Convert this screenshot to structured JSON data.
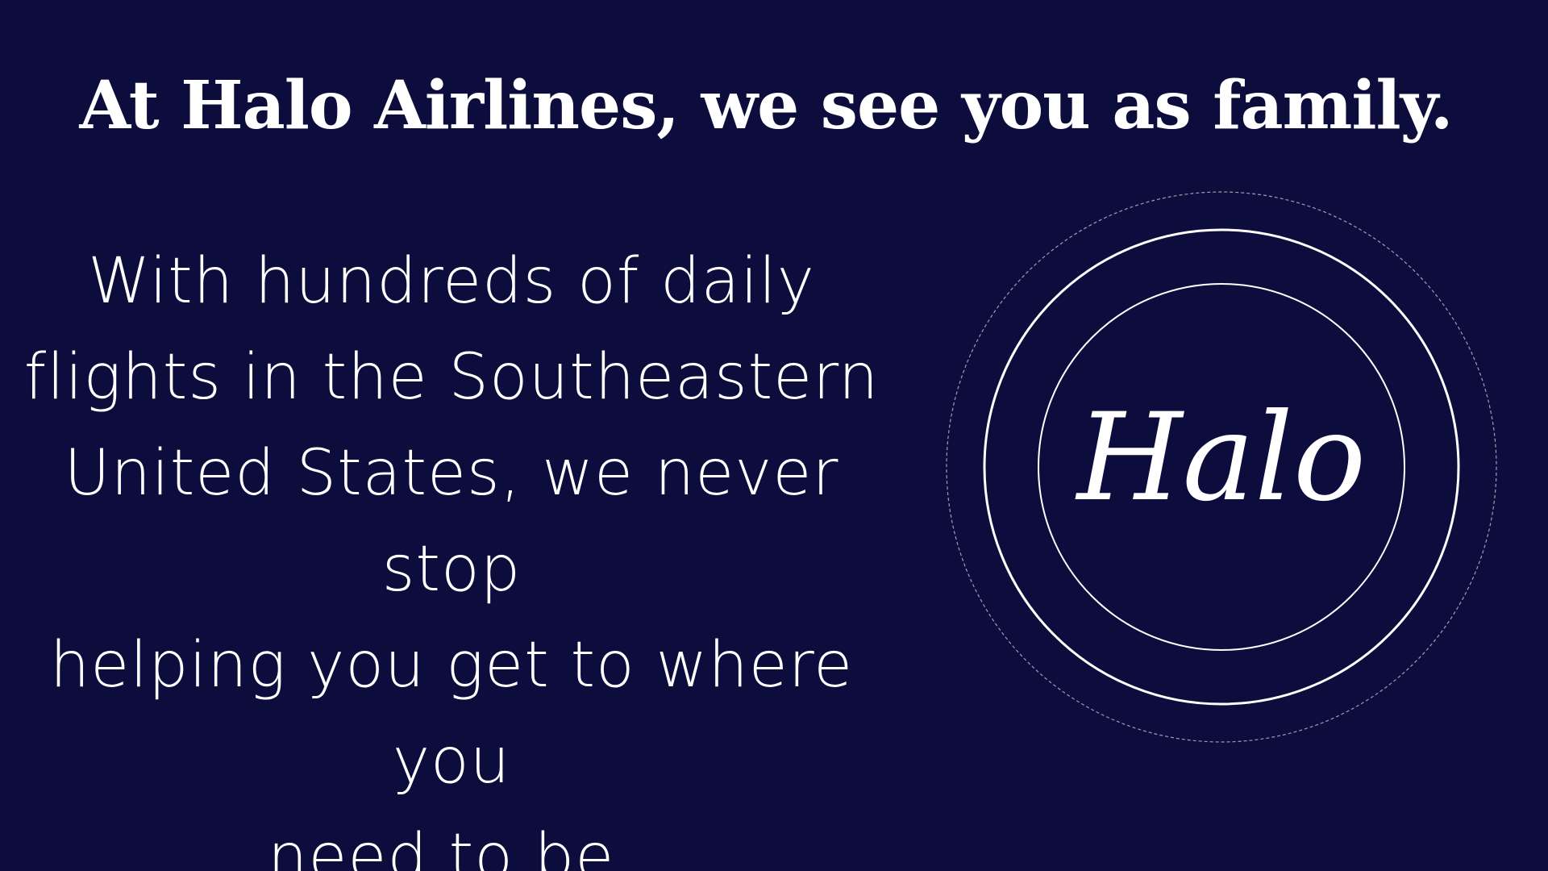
{
  "headline": "At Halo Airlines, we see you as family.",
  "body": {
    "lines": [
      "With hundreds of daily",
      "flights in the Southeastern",
      "United States, we never stop",
      "helping you get to where you",
      "need to be."
    ]
  },
  "logo": {
    "wordmark": "Halo"
  },
  "colors": {
    "background": "#0c0d3c",
    "text": "#ffffff",
    "ring": "#ffffff"
  }
}
